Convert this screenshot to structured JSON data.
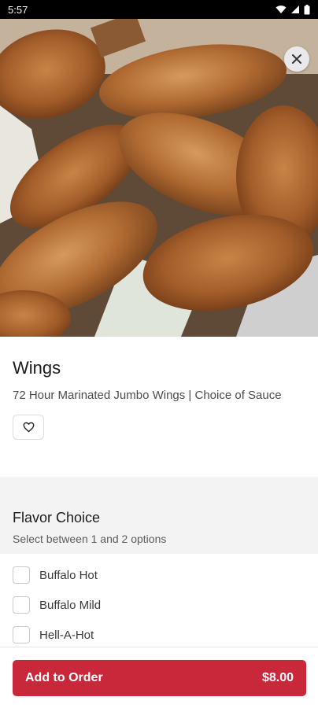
{
  "status_bar": {
    "time": "5:57"
  },
  "item": {
    "title": "Wings",
    "description": "72 Hour Marinated Jumbo Wings | Choice of Sauce"
  },
  "option_group": {
    "title": "Flavor Choice",
    "subtitle": "Select between 1 and 2 options",
    "options": [
      {
        "label": "Buffalo Hot",
        "checked": false
      },
      {
        "label": "Buffalo Mild",
        "checked": false
      },
      {
        "label": "Hell-A-Hot",
        "checked": false
      }
    ]
  },
  "footer": {
    "button_label": "Add to Order",
    "price": "$8.00"
  },
  "colors": {
    "accent": "#c8283a",
    "status_bar": "#000000",
    "section_bg": "#f3f3f4"
  },
  "icons": [
    "wifi-icon",
    "signal-icon",
    "battery-icon",
    "close-icon",
    "heart-icon"
  ]
}
